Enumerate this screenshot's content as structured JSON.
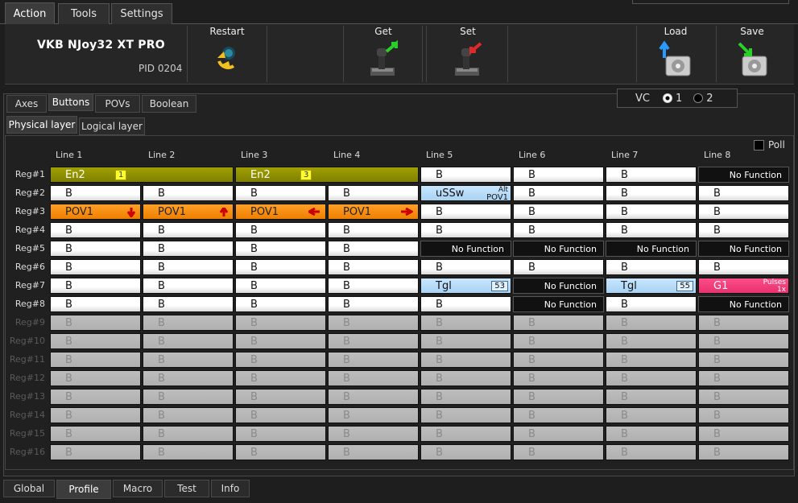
{
  "top_tabs": [
    "Action",
    "Tools",
    "Settings"
  ],
  "device": {
    "name": "VKB NJoy32 XT PRO",
    "pid": "PID 0204"
  },
  "toolbar": {
    "restart": "Restart",
    "get": "Get",
    "set": "Set",
    "load": "Load",
    "save": "Save"
  },
  "sub_tabs": [
    "Axes",
    "Buttons",
    "POVs",
    "Boolean"
  ],
  "layer_tabs": [
    "Physical layer",
    "Logical layer"
  ],
  "vc": {
    "label": "VC",
    "opt1": "1",
    "opt2": "2"
  },
  "poll": "Poll",
  "lines": [
    "Line 1",
    "Line 2",
    "Line 3",
    "Line 4",
    "Line 5",
    "Line 6",
    "Line 7",
    "Line 8"
  ],
  "regs": [
    "Reg#1",
    "Reg#2",
    "Reg#3",
    "Reg#4",
    "Reg#5",
    "Reg#6",
    "Reg#7",
    "Reg#8",
    "Reg#9",
    "Reg#10",
    "Reg#11",
    "Reg#12",
    "Reg#13",
    "Reg#14",
    "Reg#15",
    "Reg#16"
  ],
  "texts": {
    "b": "B",
    "en2": "En2",
    "en2_badge_a": "1",
    "en2_badge_b": "3",
    "pov1": "POV1",
    "nofunc": "No Function",
    "ussw": "uSSw",
    "ussw_alt": "Alt",
    "ussw_pov": "POV1",
    "tgl": "Tgl",
    "tgl_a": "53",
    "tgl_b": "55",
    "g1": "G1",
    "pulses": "Pulses",
    "pulses_n": "1x"
  },
  "bottom_tabs": [
    "Global",
    "Profile",
    "Macro",
    "Test",
    "Info"
  ]
}
